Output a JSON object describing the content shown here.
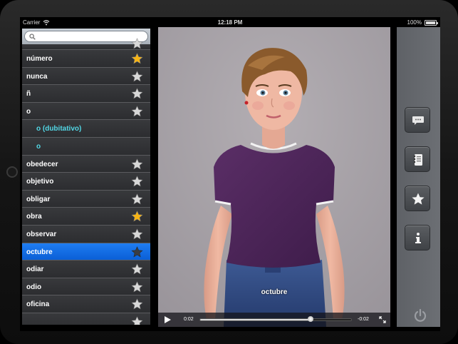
{
  "status_bar": {
    "carrier": "Carrier",
    "time": "12:18 PM",
    "battery": "100%"
  },
  "search": {
    "placeholder": ""
  },
  "list": {
    "items": [
      {
        "label": "",
        "star": "silver",
        "sub": false,
        "partial": true
      },
      {
        "label": "número",
        "star": "gold",
        "sub": false
      },
      {
        "label": "nunca",
        "star": "silver",
        "sub": false
      },
      {
        "label": "ñ",
        "star": "silver",
        "sub": false
      },
      {
        "label": "o",
        "star": "silver",
        "sub": false
      },
      {
        "label": "o (dubitativo)",
        "star": "none",
        "sub": true
      },
      {
        "label": "o",
        "star": "none",
        "sub": true
      },
      {
        "label": "obedecer",
        "star": "silver",
        "sub": false
      },
      {
        "label": "objetivo",
        "star": "silver",
        "sub": false
      },
      {
        "label": "obligar",
        "star": "silver",
        "sub": false
      },
      {
        "label": "obra",
        "star": "gold",
        "sub": false
      },
      {
        "label": "observar",
        "star": "silver",
        "sub": false
      },
      {
        "label": "octubre",
        "star": "dark",
        "sub": false,
        "selected": true
      },
      {
        "label": "odiar",
        "star": "silver",
        "sub": false
      },
      {
        "label": "odio",
        "star": "silver",
        "sub": false
      },
      {
        "label": "oficina",
        "star": "silver",
        "sub": false
      },
      {
        "label": "",
        "star": "silver",
        "sub": false
      }
    ]
  },
  "video": {
    "caption": "octubre",
    "elapsed": "0:02",
    "remaining": "-0:02",
    "progress": 0.73
  },
  "toolbar": {
    "buttons": [
      "chat-icon",
      "notebook-icon",
      "star-icon",
      "info-icon"
    ],
    "power": "power-icon"
  },
  "colors": {
    "selected_row": "#0a5fd6",
    "sub_item_text": "#52d8e6",
    "gold_star": "#f6b415",
    "video_bg": "#a5a1a6"
  }
}
